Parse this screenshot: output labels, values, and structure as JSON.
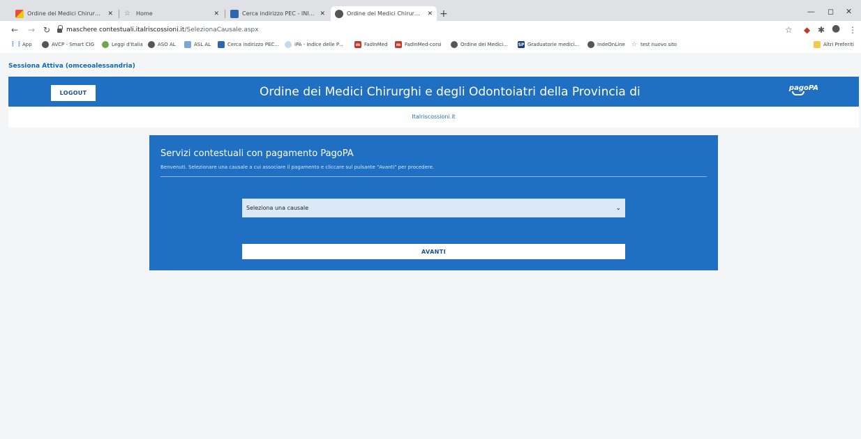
{
  "browser": {
    "tabs": [
      {
        "label": "Ordine dei Medici Chirurghi e d",
        "active": false
      },
      {
        "label": "Home",
        "active": false
      },
      {
        "label": "Cerca indirizzo PEC - INI-PEC",
        "active": false
      },
      {
        "label": "Ordine dei Medici Chirurghi e de",
        "active": true
      }
    ],
    "new_tab": "+",
    "url_host": "maschere contestuali.italriscossioni.it",
    "url_path": "/SelezionaCausale.aspx",
    "bookmarks": [
      {
        "label": "App"
      },
      {
        "label": "AVCP - Smart CIG"
      },
      {
        "label": "Leggi d'Italia"
      },
      {
        "label": "ASO AL"
      },
      {
        "label": "ASL AL"
      },
      {
        "label": "Cerca indirizzo PEC..."
      },
      {
        "label": "iPA - Indice delle P..."
      },
      {
        "label": "FadInMed"
      },
      {
        "label": "FadInMed-corsi"
      },
      {
        "label": "Ordine dei Medici..."
      },
      {
        "label": "Graduatorie medici..."
      },
      {
        "label": "IndeOnLine"
      },
      {
        "label": "test nuovo sito"
      }
    ],
    "other_bookmarks": "Altri Preferiti"
  },
  "page": {
    "session": "Sessiona Attiva (omceoalessandria)",
    "logout_label": "LOGOUT",
    "header_title": "Ordine dei Medici Chirurghi e degli Odontoiatri della Provincia di",
    "logo_text": "pagoPA",
    "sublink": "Italriscossioni.it",
    "card_title": "Servizi contestuali con pagamento PagoPA",
    "card_desc": "Benvenuti. Selezionare una causale a cui associare il pagamento e cliccare sul pulsante \"Avanti\" per procedere.",
    "select_value": "Seleziona una causale",
    "avanti_label": "AVANTI"
  },
  "colors": {
    "brand_blue": "#1f6fc3",
    "select_bg": "#dbe8f6",
    "page_bg": "#f4f5f7"
  }
}
